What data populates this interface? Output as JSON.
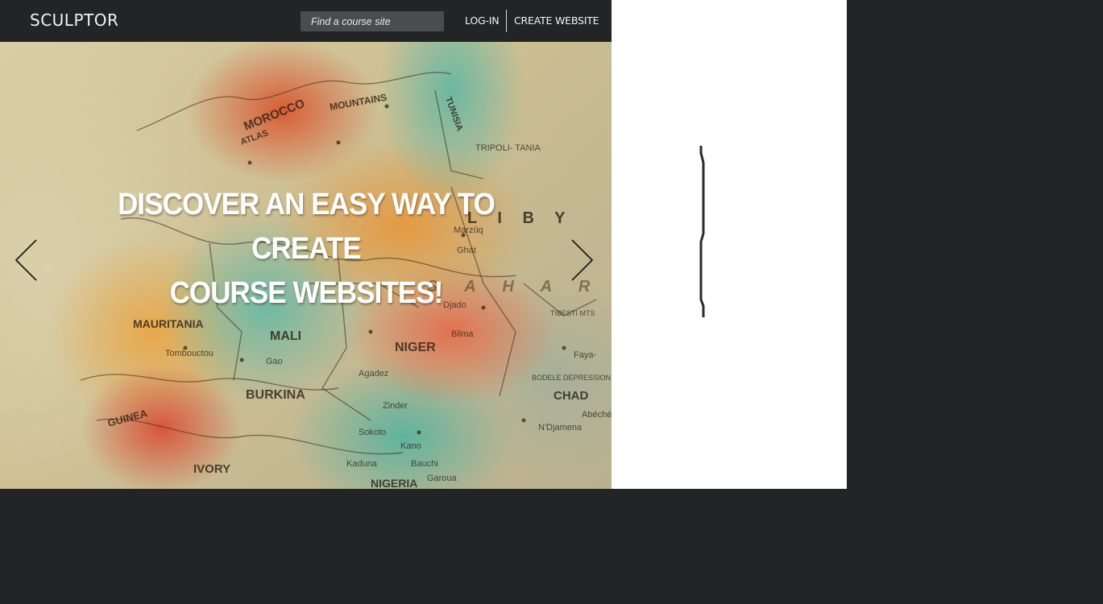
{
  "header": {
    "logo": "SCULPTOR",
    "search_placeholder": "Find a course site",
    "login_label": "LOG-IN",
    "create_label": "CREATE WEBSITE"
  },
  "hero": {
    "title_line1": "DISCOVER AN EASY WAY TO CREATE",
    "title_line2": "COURSE WEBSITES!",
    "prev_icon": "chevron-left-icon",
    "next_icon": "chevron-right-icon"
  },
  "map_labels": {
    "morocco": "MOROCCO",
    "tunisia": "TUNISIA",
    "mauritania": "MAURITANIA",
    "mali": "MALI",
    "niger": "NIGER",
    "chad": "CHAD",
    "burkina": "BURKINA",
    "nigeria": "NIGERIA",
    "libya": "L I B Y",
    "sahara": "S A H A R",
    "tripolitania": "TRIPOLI-\nTANIA",
    "atlas": "ATLAS",
    "mountains": "MOUNTAINS",
    "guinea": "GUINEA",
    "ivory": "IVORY",
    "kano": "Kano",
    "zinder": "Zinder",
    "agadez": "Agadez",
    "tombouctou": "Tombouctou",
    "gao": "Gao",
    "bilma": "Bilma",
    "djado": "Djado",
    "ghat": "Ghat",
    "marzuq": "Marzûq",
    "sokoto": "Sokoto",
    "kaduna": "Kaduna",
    "bauchi": "Bauchi",
    "garoua": "Garoua",
    "ndjamena": "N'Djamena",
    "abeche": "Abéché",
    "faya": "Faya-",
    "tibesti": "TIBESTI\nMTS",
    "bodele": "BODELE\nDEPRESSION"
  },
  "colors": {
    "header_bg": "#232426",
    "page_bg": "#232426",
    "side_panel_bg": "#ffffff",
    "hero_text": "#ffffff",
    "search_bg": "#4b4c4f"
  }
}
